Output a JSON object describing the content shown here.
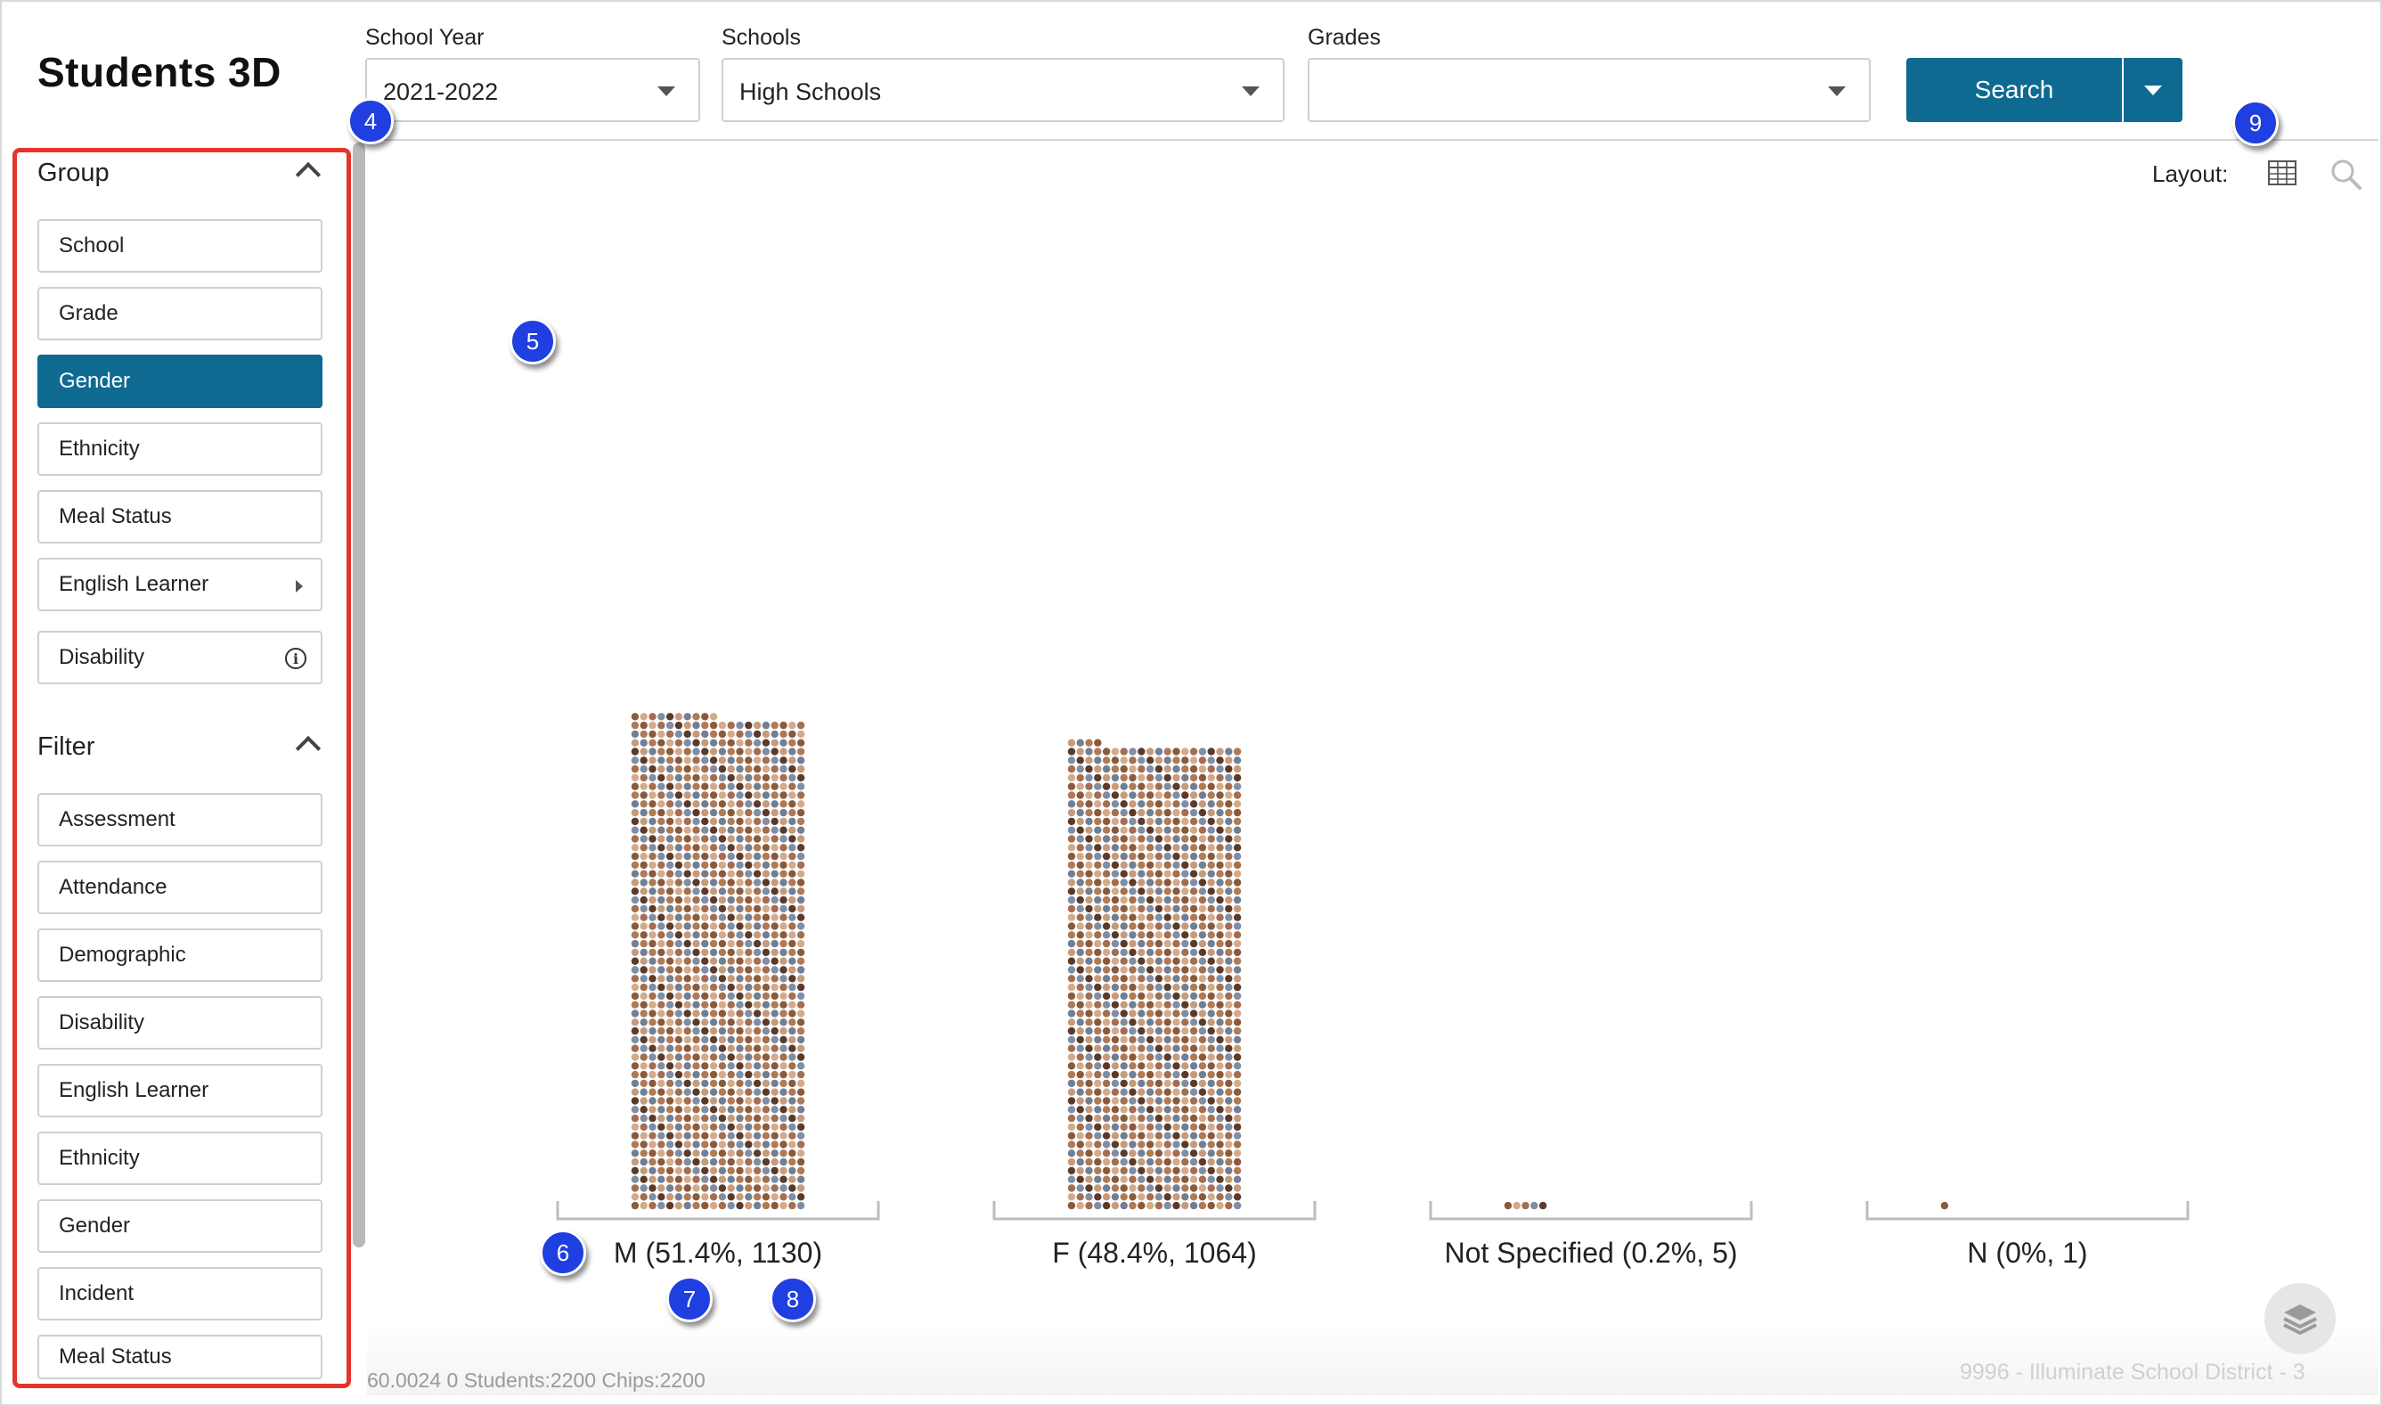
{
  "app": {
    "title": "Students 3D"
  },
  "filters": {
    "school_year": {
      "label": "School Year",
      "value": "2021-2022"
    },
    "schools": {
      "label": "Schools",
      "value": "High Schools"
    },
    "grades": {
      "label": "Grades",
      "value": ""
    },
    "search_label": "Search"
  },
  "sidebar": {
    "group": {
      "title": "Group",
      "items": [
        {
          "label": "School",
          "active": false
        },
        {
          "label": "Grade",
          "active": false
        },
        {
          "label": "Gender",
          "active": true
        },
        {
          "label": "Ethnicity",
          "active": false
        },
        {
          "label": "Meal Status",
          "active": false
        },
        {
          "label": "English Learner",
          "active": false,
          "has_submenu": true
        },
        {
          "label": "Disability",
          "active": false,
          "has_info": true
        }
      ]
    },
    "filter": {
      "title": "Filter",
      "items": [
        {
          "label": "Assessment"
        },
        {
          "label": "Attendance"
        },
        {
          "label": "Demographic"
        },
        {
          "label": "Disability"
        },
        {
          "label": "English Learner"
        },
        {
          "label": "Ethnicity"
        },
        {
          "label": "Gender"
        },
        {
          "label": "Incident"
        },
        {
          "label": "Meal Status"
        }
      ]
    }
  },
  "layout": {
    "label": "Layout:"
  },
  "markers": [
    "4",
    "5",
    "6",
    "7",
    "8",
    "9"
  ],
  "status": {
    "text": "60.0024 0 Students:2200 Chips:2200"
  },
  "district": {
    "text": "9996 - Illuminate School District - 3"
  },
  "icons": {
    "grid": "grid-layout-icon",
    "zoom": "zoom-icon",
    "layers": "layers-icon"
  },
  "colors": {
    "accent": "#0f6a92",
    "highlight": "#e5342a",
    "marker": "#1f3fe0"
  },
  "chart_data": {
    "type": "bar",
    "categories": [
      "M",
      "F",
      "Not Specified",
      "N"
    ],
    "labels": [
      "M (51.4%, 1130)",
      "F (48.4%, 1064)",
      "Not Specified (0.2%, 5)",
      "N (0%, 1)"
    ],
    "values": [
      1130,
      1064,
      5,
      1
    ],
    "percent": [
      51.4,
      48.4,
      0.2,
      0
    ],
    "total_students": 2200
  }
}
